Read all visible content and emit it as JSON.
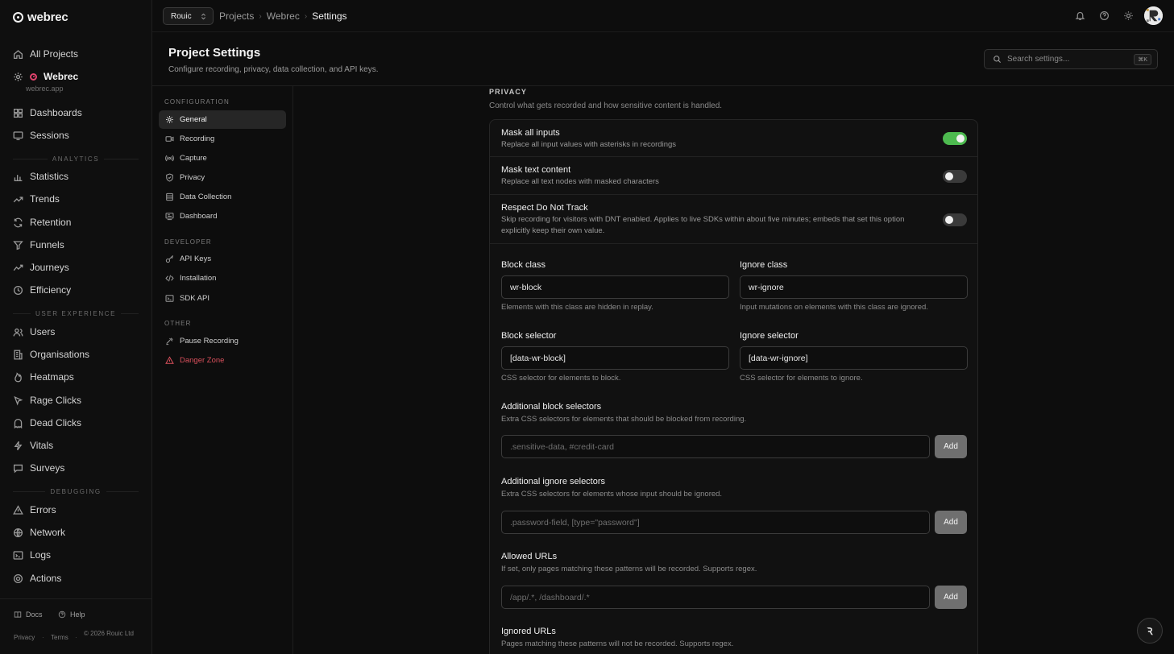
{
  "app": {
    "name": "webrec"
  },
  "sidebar": {
    "all_projects": "All Projects",
    "project": {
      "name": "Webrec",
      "domain": "webrec.app"
    },
    "top_items": [
      {
        "label": "Dashboards",
        "icon": "grid-icon"
      },
      {
        "label": "Sessions",
        "icon": "monitor-icon"
      }
    ],
    "sections": [
      {
        "title": "ANALYTICS",
        "items": [
          {
            "label": "Statistics",
            "icon": "bar-chart-icon"
          },
          {
            "label": "Trends",
            "icon": "trend-icon"
          },
          {
            "label": "Retention",
            "icon": "refresh-icon"
          },
          {
            "label": "Funnels",
            "icon": "funnel-icon"
          },
          {
            "label": "Journeys",
            "icon": "route-icon"
          },
          {
            "label": "Efficiency",
            "icon": "clock-icon"
          }
        ]
      },
      {
        "title": "USER EXPERIENCE",
        "items": [
          {
            "label": "Users",
            "icon": "users-icon"
          },
          {
            "label": "Organisations",
            "icon": "building-icon"
          },
          {
            "label": "Heatmaps",
            "icon": "flame-icon"
          },
          {
            "label": "Rage Clicks",
            "icon": "cursor-icon"
          },
          {
            "label": "Dead Clicks",
            "icon": "ghost-icon"
          },
          {
            "label": "Vitals",
            "icon": "bolt-icon"
          },
          {
            "label": "Surveys",
            "icon": "message-icon"
          }
        ]
      },
      {
        "title": "DEBUGGING",
        "items": [
          {
            "label": "Errors",
            "icon": "warning-icon"
          },
          {
            "label": "Network",
            "icon": "globe-icon"
          },
          {
            "label": "Logs",
            "icon": "terminal-icon"
          },
          {
            "label": "Actions",
            "icon": "target-icon"
          }
        ]
      }
    ],
    "footer": {
      "docs": "Docs",
      "help": "Help",
      "privacy": "Privacy",
      "terms": "Terms",
      "copyright": "© 2026 Rouic Ltd"
    }
  },
  "topbar": {
    "org": "Rouic",
    "breadcrumbs": [
      "Projects",
      "Webrec",
      "Settings"
    ]
  },
  "header": {
    "title": "Project Settings",
    "subtitle": "Configure recording, privacy, data collection, and API keys.",
    "search_placeholder": "Search settings...",
    "search_shortcut": "⌘K"
  },
  "settings_nav": {
    "groups": [
      {
        "title": "CONFIGURATION",
        "items": [
          {
            "label": "General",
            "icon": "gear-icon",
            "active": true
          },
          {
            "label": "Recording",
            "icon": "video-icon"
          },
          {
            "label": "Capture",
            "icon": "broadcast-icon"
          },
          {
            "label": "Privacy",
            "icon": "shield-icon"
          },
          {
            "label": "Data Collection",
            "icon": "database-icon"
          },
          {
            "label": "Dashboard",
            "icon": "layout-icon"
          }
        ]
      },
      {
        "title": "DEVELOPER",
        "items": [
          {
            "label": "API Keys",
            "icon": "key-icon"
          },
          {
            "label": "Installation",
            "icon": "code-icon"
          },
          {
            "label": "SDK API",
            "icon": "terminal-icon"
          }
        ]
      },
      {
        "title": "OTHER",
        "items": [
          {
            "label": "Pause Recording",
            "icon": "pause-icon"
          },
          {
            "label": "Danger Zone",
            "icon": "alert-triangle-icon",
            "danger": true
          }
        ]
      }
    ]
  },
  "privacy": {
    "title": "PRIVACY",
    "description": "Control what gets recorded and how sensitive content is handled.",
    "toggles": [
      {
        "title": "Mask all inputs",
        "description": "Replace all input values with asterisks in recordings",
        "on": true
      },
      {
        "title": "Mask text content",
        "description": "Replace all text nodes with masked characters",
        "on": false
      },
      {
        "title": "Respect Do Not Track",
        "description": "Skip recording for visitors with DNT enabled. Applies to live SDKs within about five minutes; embeds that set this option explicitly keep their own value.",
        "on": false
      }
    ],
    "block_class": {
      "label": "Block class",
      "value": "wr-block",
      "help": "Elements with this class are hidden in replay."
    },
    "ignore_class": {
      "label": "Ignore class",
      "value": "wr-ignore",
      "help": "Input mutations on elements with this class are ignored."
    },
    "block_selector": {
      "label": "Block selector",
      "value": "[data-wr-block]",
      "help": "CSS selector for elements to block."
    },
    "ignore_selector": {
      "label": "Ignore selector",
      "value": "[data-wr-ignore]",
      "help": "CSS selector for elements to ignore."
    },
    "additional_block": {
      "label": "Additional block selectors",
      "help": "Extra CSS selectors for elements that should be blocked from recording.",
      "placeholder": ".sensitive-data, #credit-card",
      "button": "Add"
    },
    "additional_ignore": {
      "label": "Additional ignore selectors",
      "help": "Extra CSS selectors for elements whose input should be ignored.",
      "placeholder": ".password-field, [type=\"password\"]",
      "button": "Add"
    },
    "allowed_urls": {
      "label": "Allowed URLs",
      "help": "If set, only pages matching these patterns will be recorded. Supports regex.",
      "placeholder": "/app/.*, /dashboard/.*",
      "button": "Add"
    },
    "ignored_urls": {
      "label": "Ignored URLs",
      "help": "Pages matching these patterns will not be recorded. Supports regex."
    }
  },
  "colors": {
    "toggle_on": "#4dba4f",
    "danger": "#d9505c",
    "project_dot": "#e0436d"
  }
}
